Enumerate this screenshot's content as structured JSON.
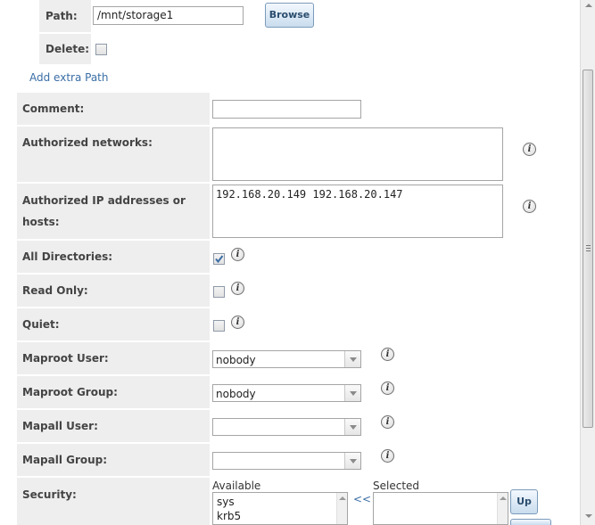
{
  "path": {
    "label": "Path:",
    "value": "/mnt/storage1",
    "browse_label": "Browse"
  },
  "delete": {
    "label": "Delete:",
    "checked": false
  },
  "add_extra_path": "Add extra Path",
  "comment": {
    "label": "Comment:",
    "value": ""
  },
  "authorized_networks": {
    "label": "Authorized networks:",
    "value": ""
  },
  "authorized_hosts": {
    "label_line1": "Authorized IP addresses or",
    "label_line2": "hosts:",
    "value": "192.168.20.149 192.168.20.147"
  },
  "all_directories": {
    "label": "All Directories:",
    "checked": true
  },
  "read_only": {
    "label": "Read Only:",
    "checked": false
  },
  "quiet": {
    "label": "Quiet:",
    "checked": false
  },
  "maproot_user": {
    "label": "Maproot User:",
    "value": "nobody"
  },
  "maproot_group": {
    "label": "Maproot Group:",
    "value": "nobody"
  },
  "mapall_user": {
    "label": "Mapall User:",
    "value": ""
  },
  "mapall_group": {
    "label": "Mapall Group:",
    "value": ""
  },
  "security": {
    "label": "Security:",
    "available_label": "Available",
    "selected_label": "Selected",
    "available_items": [
      "sys",
      "krb5"
    ],
    "move_left_label": "<<",
    "up_label": "Up"
  },
  "info_glyph": "i"
}
